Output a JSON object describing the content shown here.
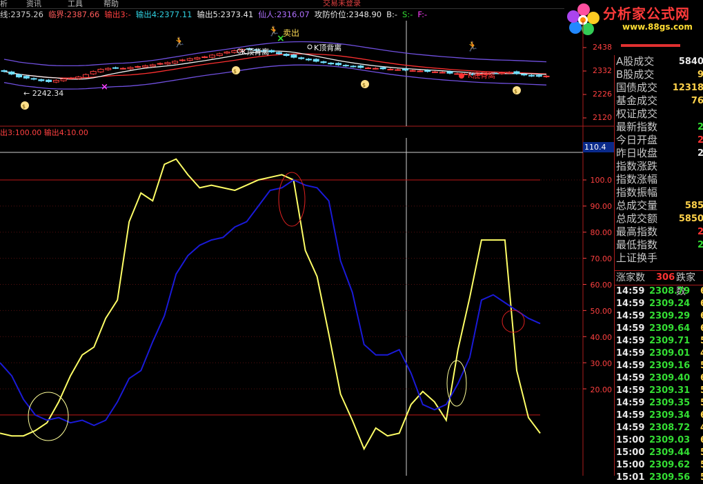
{
  "menu": {
    "items": [
      "析",
      "资讯",
      "工具",
      "帮助"
    ],
    "center_title": "交易未登录"
  },
  "logo": {
    "name": "分析家公式网",
    "url": "www.88gs.com"
  },
  "infobar": {
    "fields": [
      {
        "text": "线:2375.26",
        "color": "#d0d0d0"
      },
      {
        "text": "临界:2387.66",
        "color": "#ff5a5a"
      },
      {
        "text": "输出3:-",
        "color": "#ff4040"
      },
      {
        "text": "输出4:2377.11",
        "color": "#30d0e0"
      },
      {
        "text": "输出5:2373.41",
        "color": "#e8e8e8"
      },
      {
        "text": "仙人:2316.07",
        "color": "#b070ff"
      },
      {
        "text": "攻防价位:2348.90",
        "color": "#e8e8e8"
      },
      {
        "text": "B:-",
        "color": "#e8e8e8"
      },
      {
        "text": "S:-",
        "color": "#33dd33"
      },
      {
        "text": "F:-",
        "color": "#ff40ff"
      }
    ]
  },
  "price_axis": {
    "labels": [
      "2438",
      "2332",
      "2226",
      "2120"
    ]
  },
  "price_annotations": {
    "sell_label": "卖出",
    "k_top_1": "K顶背离",
    "k_top_2": "K顶背离",
    "k_bottom": "K底背离",
    "low_label": "← 2242.34"
  },
  "osc_legend": "出3:100.00  输出4:10.00",
  "osc_current": "110.4",
  "osc_axis": {
    "labels": [
      "100.0",
      "90.00",
      "80.00",
      "70.00",
      "60.00",
      "50.00",
      "40.00",
      "30.00",
      "20.00"
    ]
  },
  "right_panel": {
    "stats": [
      {
        "label": "A股成交",
        "value": "5840",
        "cls": "white"
      },
      {
        "label": "B股成交",
        "value": "9",
        "cls": ""
      },
      {
        "label": "国债成交",
        "value": "12318",
        "cls": ""
      },
      {
        "label": "基金成交",
        "value": "76",
        "cls": ""
      },
      {
        "label": "权证成交",
        "value": "",
        "cls": ""
      },
      {
        "label": "最新指数",
        "value": "2",
        "cls": "green"
      },
      {
        "label": "今日开盘",
        "value": "2",
        "cls": "red"
      },
      {
        "label": "昨日收盘",
        "value": "2",
        "cls": "white"
      },
      {
        "label": "指数涨跌",
        "value": "",
        "cls": ""
      },
      {
        "label": "指数涨幅",
        "value": "",
        "cls": ""
      },
      {
        "label": "指数振幅",
        "value": "",
        "cls": ""
      },
      {
        "label": "总成交量",
        "value": "585",
        "cls": ""
      },
      {
        "label": "总成交额",
        "value": "5850",
        "cls": ""
      },
      {
        "label": "最高指数",
        "value": "2",
        "cls": "red"
      },
      {
        "label": "最低指数",
        "value": "2",
        "cls": "green"
      },
      {
        "label": "上证换手",
        "value": "",
        "cls": ""
      }
    ],
    "updown": {
      "up_label": "涨家数",
      "up_count": "306",
      "down_label": "跌家数"
    },
    "ticks": [
      {
        "time": "14:59",
        "price": "2308.79",
        "vol": "6"
      },
      {
        "time": "14:59",
        "price": "2309.24",
        "vol": "6"
      },
      {
        "time": "14:59",
        "price": "2309.29",
        "vol": "6"
      },
      {
        "time": "14:59",
        "price": "2309.64",
        "vol": "6"
      },
      {
        "time": "14:59",
        "price": "2309.71",
        "vol": "5"
      },
      {
        "time": "14:59",
        "price": "2309.01",
        "vol": "4"
      },
      {
        "time": "14:59",
        "price": "2309.16",
        "vol": "5"
      },
      {
        "time": "14:59",
        "price": "2309.40",
        "vol": "6"
      },
      {
        "time": "14:59",
        "price": "2309.31",
        "vol": "5"
      },
      {
        "time": "14:59",
        "price": "2309.35",
        "vol": "5"
      },
      {
        "time": "14:59",
        "price": "2309.34",
        "vol": "6"
      },
      {
        "time": "14:59",
        "price": "2308.72",
        "vol": "4"
      },
      {
        "time": "15:00",
        "price": "2309.03",
        "vol": "6"
      },
      {
        "time": "15:00",
        "price": "2309.44",
        "vol": "5"
      },
      {
        "time": "15:00",
        "price": "2309.62",
        "vol": "5"
      },
      {
        "time": "15:01",
        "price": "2309.56",
        "vol": "5"
      }
    ]
  },
  "colors": {
    "panel_border": "#ab1d1d",
    "yellow_line": "#ffff66",
    "blue_line": "#1a1ad8",
    "ma_red": "#ff3030",
    "ma_white": "#f0f0f0",
    "band_purple": "#7050e0",
    "candle_up": "#70e0ff"
  },
  "chart_data": {
    "type": "line",
    "title": "",
    "price_chart": {
      "ylim": [
        2120,
        2438
      ],
      "ticks": [
        2120,
        2226,
        2332,
        2438
      ]
    },
    "oscillator": {
      "ylim": [
        0,
        110
      ],
      "ticks": [
        20,
        30,
        40,
        50,
        60,
        70,
        80,
        90,
        100
      ],
      "reference_lines": [
        100,
        10
      ],
      "series": [
        {
          "name": "",
          "color": "#ffff66",
          "values": [
            3,
            2,
            2,
            4,
            7,
            15,
            25,
            33,
            36,
            47,
            54,
            84,
            95,
            92,
            106,
            108,
            102,
            97,
            98,
            97,
            96,
            98,
            100,
            101,
            102,
            100,
            73,
            63,
            41,
            18,
            8,
            -3,
            5,
            2,
            3,
            14,
            19,
            15,
            8,
            35,
            55,
            77,
            77,
            77,
            27,
            9,
            3
          ]
        },
        {
          "name": "",
          "color": "#1a1ad8",
          "values": [
            30,
            25,
            16,
            10,
            8,
            9,
            7,
            8,
            6,
            8,
            15,
            24,
            27,
            38,
            48,
            64,
            71,
            75,
            77,
            78,
            82,
            84,
            90,
            96,
            97,
            100,
            98,
            97,
            92,
            69,
            57,
            37,
            33,
            33,
            35,
            26,
            14,
            12,
            14,
            22,
            32,
            54,
            56,
            53,
            50,
            47,
            45
          ]
        }
      ]
    }
  }
}
